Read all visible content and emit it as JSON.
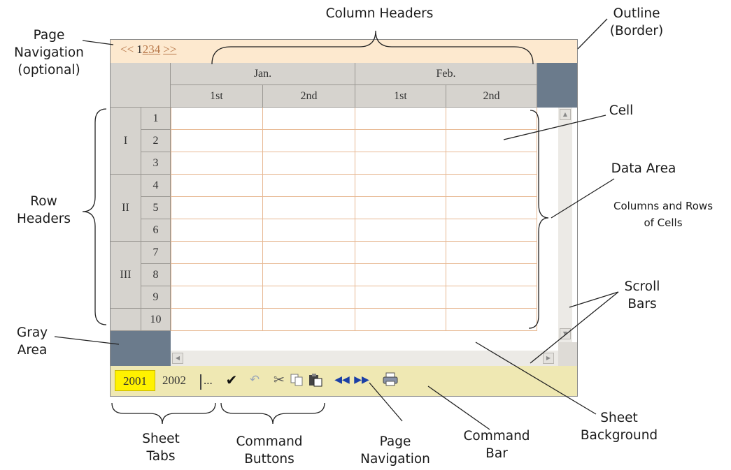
{
  "labels": {
    "column_headers": "Column Headers",
    "outline": [
      "Outline",
      "(Border)"
    ],
    "page_nav_optional": [
      "Page",
      "Navigation",
      "(optional)"
    ],
    "cell": "Cell",
    "data_area": "Data Area",
    "columns_rows": [
      "Columns and Rows",
      "of Cells"
    ],
    "row_headers": [
      "Row",
      "Headers"
    ],
    "scroll_bars": [
      "Scroll",
      "Bars"
    ],
    "gray_area": [
      "Gray",
      "Area"
    ],
    "sheet_background": [
      "Sheet",
      "Background"
    ],
    "command_bar": [
      "Command",
      "Bar"
    ],
    "sheet_tabs": [
      "Sheet",
      "Tabs"
    ],
    "command_buttons": [
      "Command",
      "Buttons"
    ],
    "page_navigation": [
      "Page",
      "Navigation"
    ]
  },
  "sheet": {
    "page_nav": {
      "prev": "<<",
      "pages": [
        "1",
        "2",
        "3",
        "4"
      ],
      "next": ">>"
    },
    "months": [
      "Jan.",
      "Feb."
    ],
    "halves": [
      "1st",
      "2nd",
      "1st",
      "2nd"
    ],
    "row_groups": [
      "I",
      "II",
      "III"
    ],
    "row_numbers": [
      "1",
      "2",
      "3",
      "4",
      "5",
      "6",
      "7",
      "8",
      "9",
      "10"
    ],
    "tabs": [
      "2001",
      "2002"
    ],
    "tabs_more": "...",
    "command_icons": [
      "check-icon",
      "undo-icon",
      "cut-icon",
      "copy-icon",
      "paste-icon",
      "page-prev-icon",
      "page-next-icon",
      "print-icon"
    ]
  },
  "colors": {
    "header_gray": "#d6d3ce",
    "slate_area": "#6b7b8c",
    "page_nav_bg": "#fde9cf",
    "command_bar_bg": "#efe8b3",
    "active_tab": "#fff200",
    "cell_grid": "#e7b892"
  }
}
